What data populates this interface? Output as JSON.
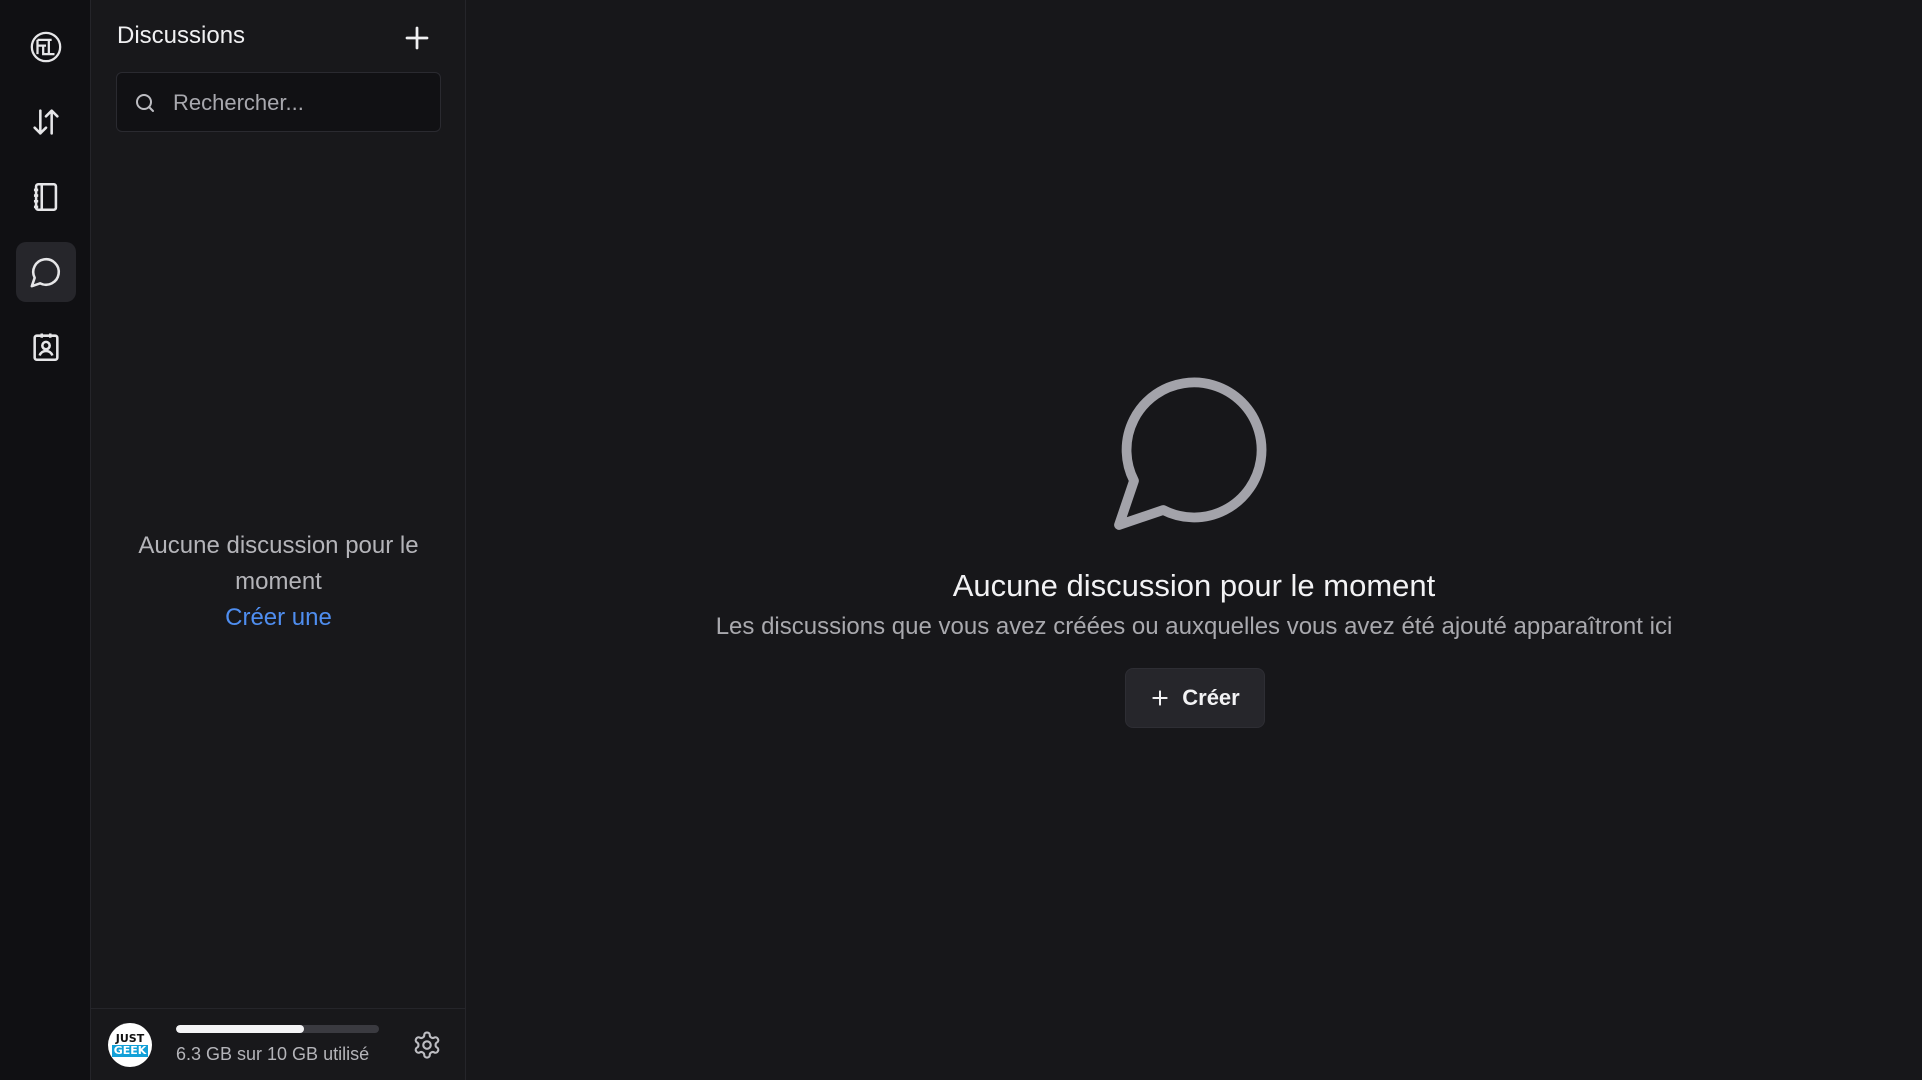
{
  "rail": {
    "items": [
      {
        "name": "logo",
        "icon": "logo-icon"
      },
      {
        "name": "transfers",
        "icon": "arrows-up-down-icon"
      },
      {
        "name": "notebook",
        "icon": "notebook-icon"
      },
      {
        "name": "discussions",
        "icon": "chat-bubble-icon",
        "active": true
      },
      {
        "name": "contacts",
        "icon": "contact-card-icon"
      }
    ]
  },
  "panel": {
    "title": "Discussions",
    "search_placeholder": "Rechercher...",
    "empty_message": "Aucune discussion pour le moment",
    "empty_link": "Créer une"
  },
  "footer": {
    "avatar": {
      "line1": "JUST",
      "line2": "GEEK"
    },
    "storage_text": "6.3 GB sur 10 GB utilisé",
    "storage_used_fraction": 0.63
  },
  "main": {
    "title": "Aucune discussion pour le moment",
    "subtitle": "Les discussions que vous avez créées ou auxquelles vous avez été ajouté apparaîtront ici",
    "create_label": "Créer"
  },
  "colors": {
    "accent_link": "#4f8ef0",
    "background": "#17171a",
    "rail_background": "#101013"
  }
}
